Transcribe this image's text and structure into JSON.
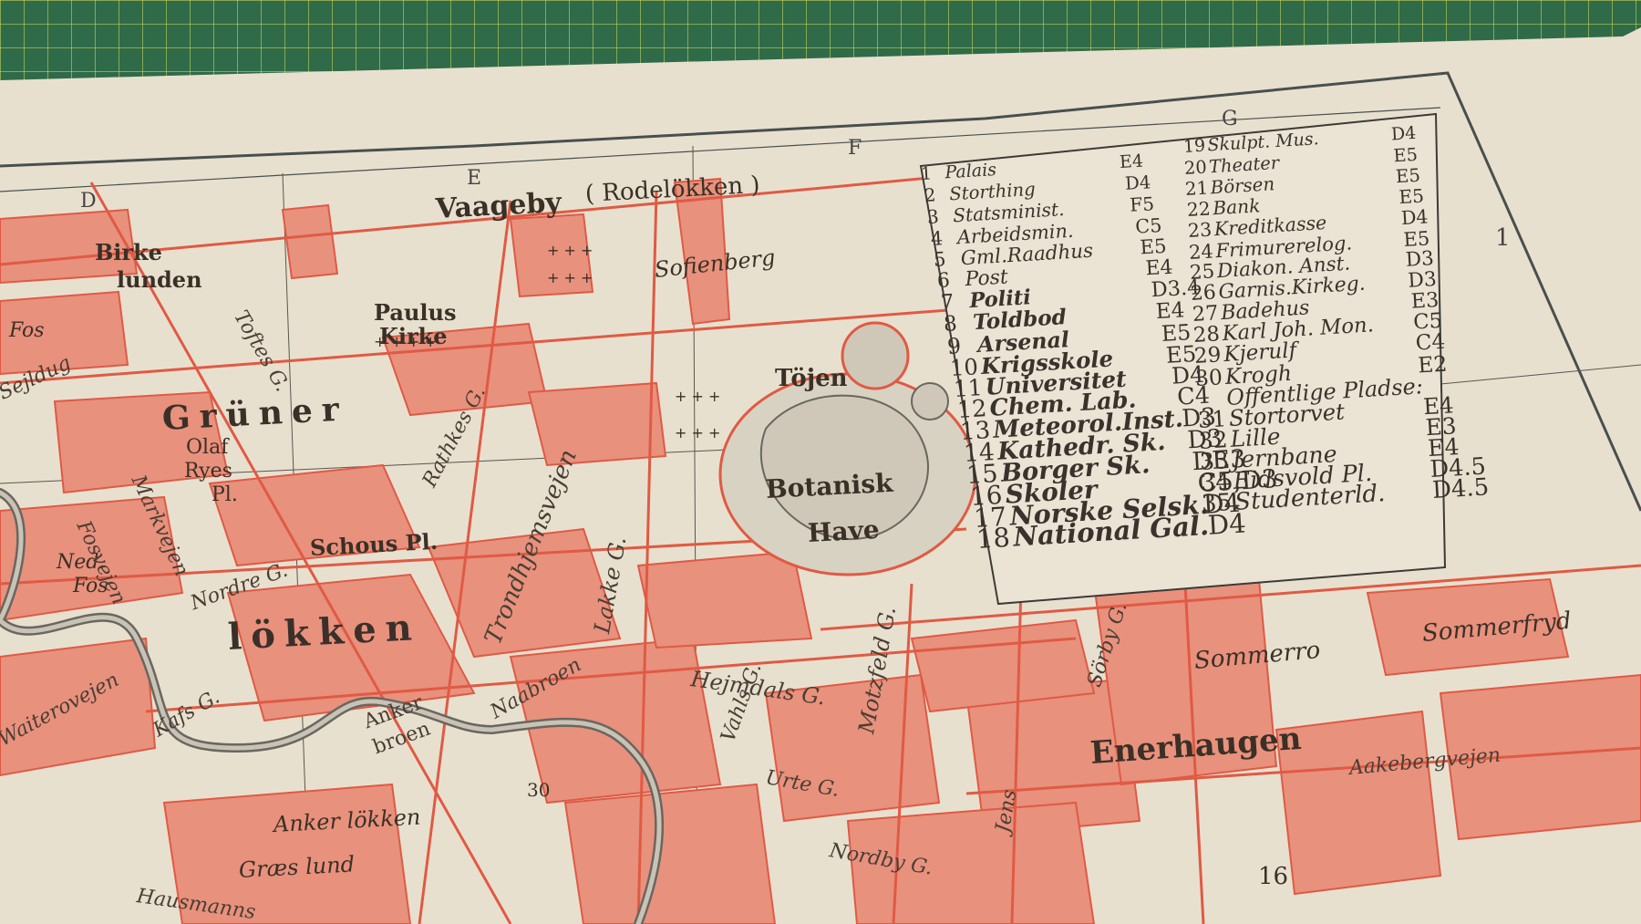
{
  "grid_letters": [
    "D",
    "E",
    "F",
    "G"
  ],
  "grid_row_number": "1",
  "legend": [
    {
      "no": "1",
      "name": "Palais",
      "code": "E4"
    },
    {
      "no": "2",
      "name": "Storthing",
      "code": "D4"
    },
    {
      "no": "3",
      "name": "Statsminist.",
      "code": "F5"
    },
    {
      "no": "4",
      "name": "Arbeidsmin.",
      "code": "C5"
    },
    {
      "no": "5",
      "name": "Gml.Raadhus",
      "code": "E5"
    },
    {
      "no": "6",
      "name": "Post",
      "code": "E4"
    },
    {
      "no": "7",
      "name": "Politi",
      "code": "D3.4"
    },
    {
      "no": "8",
      "name": "Toldbod",
      "code": "E4"
    },
    {
      "no": "9",
      "name": "Arsenal",
      "code": "E5"
    },
    {
      "no": "10",
      "name": "Krigsskole",
      "code": "E5"
    },
    {
      "no": "11",
      "name": "Universitet",
      "code": "D4"
    },
    {
      "no": "12",
      "name": "Chem. Lab.",
      "code": "C4"
    },
    {
      "no": "13",
      "name": "Meteorol.Inst.",
      "code": "D3"
    },
    {
      "no": "14",
      "name": "Kathedr. Sk.",
      "code": "D3"
    },
    {
      "no": "15",
      "name": "Borger Sk.",
      "code": "DE3"
    },
    {
      "no": "16",
      "name": "Skoler",
      "code": "C5,D3"
    },
    {
      "no": "17",
      "name": "Norske Selsk.",
      "code": "D4"
    },
    {
      "no": "18",
      "name": "National Gal.",
      "code": "D4"
    }
  ],
  "legend_right": [
    {
      "no": "19",
      "name": "Skulpt. Mus.",
      "code": "D4"
    },
    {
      "no": "20",
      "name": "Theater",
      "code": "E5"
    },
    {
      "no": "21",
      "name": "Börsen",
      "code": "E5"
    },
    {
      "no": "22",
      "name": "Bank",
      "code": "E5"
    },
    {
      "no": "23",
      "name": "Kreditkasse",
      "code": "D4"
    },
    {
      "no": "24",
      "name": "Frimurerelog.",
      "code": "E5"
    },
    {
      "no": "25",
      "name": "Diakon. Anst.",
      "code": "D3"
    },
    {
      "no": "26",
      "name": "Garnis.Kirkeg.",
      "code": "D3"
    },
    {
      "no": "27",
      "name": "Badehus",
      "code": "E3"
    },
    {
      "no": "28",
      "name": "Karl Joh. Mon.",
      "code": "C5"
    },
    {
      "no": "29",
      "name": "Kjerulf",
      "code": "C4"
    },
    {
      "no": "30",
      "name": "Krogh",
      "code": "E2"
    },
    {
      "no": "",
      "name": "Offentlige Pladse:",
      "code": ""
    },
    {
      "no": "31",
      "name": "Stortorvet",
      "code": "E4"
    },
    {
      "no": "32",
      "name": "Lille",
      "code": "E3"
    },
    {
      "no": "33",
      "name": "Jernbane",
      "code": "E4"
    },
    {
      "no": "34",
      "name": "Eidsvold Pl.",
      "code": "D4.5"
    },
    {
      "no": "35",
      "name": "Studenterld.",
      "code": "D4.5"
    }
  ],
  "places": {
    "vaageby": "Vaageby",
    "rodelokken": "( Rodelökken )",
    "sofienberg": "Sofienberg",
    "birke": "Birke",
    "lunden": "lunden",
    "paulus": "Paulus",
    "kirke": "Kirke",
    "gruner": "Grüner",
    "lokken": "lökken",
    "olaf": "Olaf",
    "ryes": "Ryes",
    "pl": "Pl.",
    "schous": "Schous Pl.",
    "tojen": "Töjen",
    "botanisk": "Botanisk",
    "have": "Have",
    "fos": "Fos",
    "ned": "Ned.",
    "nedfos": "Fos",
    "sommerro": "Sommerro",
    "sommerfryd": "Sommerfryd",
    "enerhaugen": "Enerhaugen",
    "ankerlokken": "Anker lökken",
    "graslund": "Græs lund",
    "kjerre": "30",
    "num16": "16"
  },
  "streets": {
    "sejldug": "Sejldug",
    "toftes": "Toftes G.",
    "rathkes": "Rathkes G.",
    "trondhjemsvejen": "Trondhjemsvejen",
    "lakke": "Lakke G.",
    "nordre": "Nordre G.",
    "hejmdals": "Hejmdals G.",
    "motzfeld": "Motzfeld G.",
    "vahls": "Vahls G.",
    "urte": "Urte G.",
    "nordby": "Nordby G.",
    "jens": "Jens",
    "aakebergvejen": "Aakebergvejen",
    "sorby": "Sörby G.",
    "anker": "Anker",
    "broen": "broen",
    "naabroen": "Naabroen",
    "kafs": "Kafs G.",
    "markvejen": "Markvejen",
    "fosvejen": "Fosvejen",
    "hausmanns": "Hausmanns",
    "vaiterovejen": "Waiterovejen"
  },
  "colors": {
    "ink_red": "#e2614f",
    "paper": "#e8e0cf",
    "mat": "#2f6b48",
    "text": "#3a3026"
  }
}
